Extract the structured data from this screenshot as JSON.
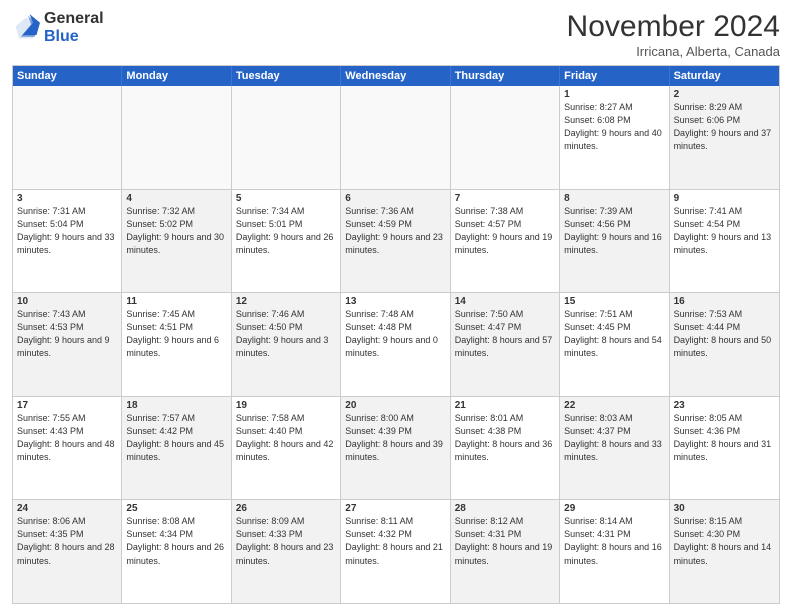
{
  "header": {
    "logo": {
      "line1": "General",
      "line2": "Blue"
    },
    "title": "November 2024",
    "subtitle": "Irricana, Alberta, Canada"
  },
  "weekdays": [
    "Sunday",
    "Monday",
    "Tuesday",
    "Wednesday",
    "Thursday",
    "Friday",
    "Saturday"
  ],
  "rows": [
    [
      {
        "day": "",
        "info": "",
        "empty": true
      },
      {
        "day": "",
        "info": "",
        "empty": true
      },
      {
        "day": "",
        "info": "",
        "empty": true
      },
      {
        "day": "",
        "info": "",
        "empty": true
      },
      {
        "day": "",
        "info": "",
        "empty": true
      },
      {
        "day": "1",
        "info": "Sunrise: 8:27 AM\nSunset: 6:08 PM\nDaylight: 9 hours and 40 minutes."
      },
      {
        "day": "2",
        "info": "Sunrise: 8:29 AM\nSunset: 6:06 PM\nDaylight: 9 hours and 37 minutes.",
        "shade": true
      }
    ],
    [
      {
        "day": "3",
        "info": "Sunrise: 7:31 AM\nSunset: 5:04 PM\nDaylight: 9 hours and 33 minutes."
      },
      {
        "day": "4",
        "info": "Sunrise: 7:32 AM\nSunset: 5:02 PM\nDaylight: 9 hours and 30 minutes.",
        "shade": true
      },
      {
        "day": "5",
        "info": "Sunrise: 7:34 AM\nSunset: 5:01 PM\nDaylight: 9 hours and 26 minutes."
      },
      {
        "day": "6",
        "info": "Sunrise: 7:36 AM\nSunset: 4:59 PM\nDaylight: 9 hours and 23 minutes.",
        "shade": true
      },
      {
        "day": "7",
        "info": "Sunrise: 7:38 AM\nSunset: 4:57 PM\nDaylight: 9 hours and 19 minutes."
      },
      {
        "day": "8",
        "info": "Sunrise: 7:39 AM\nSunset: 4:56 PM\nDaylight: 9 hours and 16 minutes.",
        "shade": true
      },
      {
        "day": "9",
        "info": "Sunrise: 7:41 AM\nSunset: 4:54 PM\nDaylight: 9 hours and 13 minutes."
      }
    ],
    [
      {
        "day": "10",
        "info": "Sunrise: 7:43 AM\nSunset: 4:53 PM\nDaylight: 9 hours and 9 minutes.",
        "shade": true
      },
      {
        "day": "11",
        "info": "Sunrise: 7:45 AM\nSunset: 4:51 PM\nDaylight: 9 hours and 6 minutes."
      },
      {
        "day": "12",
        "info": "Sunrise: 7:46 AM\nSunset: 4:50 PM\nDaylight: 9 hours and 3 minutes.",
        "shade": true
      },
      {
        "day": "13",
        "info": "Sunrise: 7:48 AM\nSunset: 4:48 PM\nDaylight: 9 hours and 0 minutes."
      },
      {
        "day": "14",
        "info": "Sunrise: 7:50 AM\nSunset: 4:47 PM\nDaylight: 8 hours and 57 minutes.",
        "shade": true
      },
      {
        "day": "15",
        "info": "Sunrise: 7:51 AM\nSunset: 4:45 PM\nDaylight: 8 hours and 54 minutes."
      },
      {
        "day": "16",
        "info": "Sunrise: 7:53 AM\nSunset: 4:44 PM\nDaylight: 8 hours and 50 minutes.",
        "shade": true
      }
    ],
    [
      {
        "day": "17",
        "info": "Sunrise: 7:55 AM\nSunset: 4:43 PM\nDaylight: 8 hours and 48 minutes."
      },
      {
        "day": "18",
        "info": "Sunrise: 7:57 AM\nSunset: 4:42 PM\nDaylight: 8 hours and 45 minutes.",
        "shade": true
      },
      {
        "day": "19",
        "info": "Sunrise: 7:58 AM\nSunset: 4:40 PM\nDaylight: 8 hours and 42 minutes."
      },
      {
        "day": "20",
        "info": "Sunrise: 8:00 AM\nSunset: 4:39 PM\nDaylight: 8 hours and 39 minutes.",
        "shade": true
      },
      {
        "day": "21",
        "info": "Sunrise: 8:01 AM\nSunset: 4:38 PM\nDaylight: 8 hours and 36 minutes."
      },
      {
        "day": "22",
        "info": "Sunrise: 8:03 AM\nSunset: 4:37 PM\nDaylight: 8 hours and 33 minutes.",
        "shade": true
      },
      {
        "day": "23",
        "info": "Sunrise: 8:05 AM\nSunset: 4:36 PM\nDaylight: 8 hours and 31 minutes."
      }
    ],
    [
      {
        "day": "24",
        "info": "Sunrise: 8:06 AM\nSunset: 4:35 PM\nDaylight: 8 hours and 28 minutes.",
        "shade": true
      },
      {
        "day": "25",
        "info": "Sunrise: 8:08 AM\nSunset: 4:34 PM\nDaylight: 8 hours and 26 minutes."
      },
      {
        "day": "26",
        "info": "Sunrise: 8:09 AM\nSunset: 4:33 PM\nDaylight: 8 hours and 23 minutes.",
        "shade": true
      },
      {
        "day": "27",
        "info": "Sunrise: 8:11 AM\nSunset: 4:32 PM\nDaylight: 8 hours and 21 minutes."
      },
      {
        "day": "28",
        "info": "Sunrise: 8:12 AM\nSunset: 4:31 PM\nDaylight: 8 hours and 19 minutes.",
        "shade": true
      },
      {
        "day": "29",
        "info": "Sunrise: 8:14 AM\nSunset: 4:31 PM\nDaylight: 8 hours and 16 minutes."
      },
      {
        "day": "30",
        "info": "Sunrise: 8:15 AM\nSunset: 4:30 PM\nDaylight: 8 hours and 14 minutes.",
        "shade": true
      }
    ]
  ]
}
